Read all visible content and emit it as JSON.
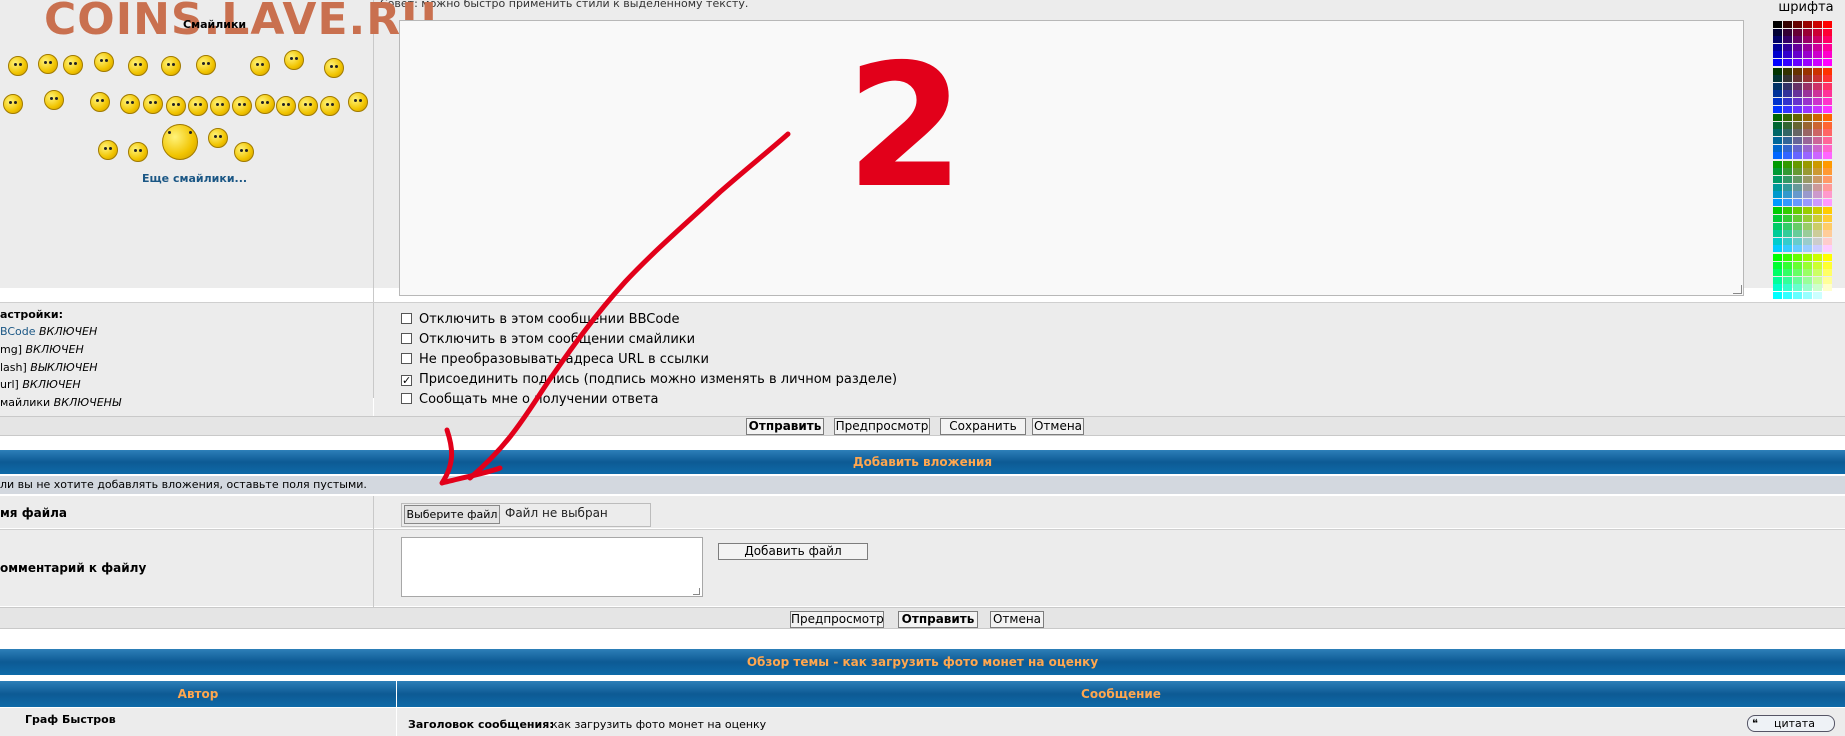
{
  "watermark": "COINS.LAVE.RU",
  "hint_text": "Совет: можно быстро применить стили к выделенному тексту.",
  "font_color_label": "шрифта",
  "smiles": {
    "title": "Смайлики",
    "more": "Еще смайлики..."
  },
  "settings": {
    "title": "астройки:",
    "lines": [
      {
        "label": "BCode",
        "value": "ВКЛЮЧЕН"
      },
      {
        "label": "mg]",
        "value": "ВКЛЮЧЕН"
      },
      {
        "label": "lash]",
        "value": "ВЫКЛЮЧЕН"
      },
      {
        "label": "url]",
        "value": "ВКЛЮЧЕН"
      },
      {
        "label": "майлики",
        "value": "ВКЛЮЧЕНЫ"
      }
    ]
  },
  "options": [
    {
      "label": "Отключить в этом сообщении BBCode",
      "checked": false
    },
    {
      "label": "Отключить в этом сообщении смайлики",
      "checked": false
    },
    {
      "label": "Не преобразовывать адреса URL в ссылки",
      "checked": false
    },
    {
      "label": "Присоединить подпись (подпись можно изменять в личном разделе)",
      "checked": true
    },
    {
      "label": "Сообщать мне о получении ответа",
      "checked": false
    }
  ],
  "post_buttons": {
    "submit": "Отправить",
    "preview": "Предпросмотр",
    "save": "Сохранить",
    "cancel": "Отмена"
  },
  "attachments": {
    "header": "Добавить вложения",
    "hint": "ли вы не хотите добавлять вложения, оставьте поля пустыми.",
    "filename_label": "мя файла",
    "choose_file": "Выберите файл",
    "no_file": "Файл не выбран",
    "comment_label": "омментарий к файлу",
    "add_file": "Добавить файл",
    "preview": "Предпросмотр",
    "submit": "Отправить",
    "cancel": "Отмена"
  },
  "topic_review": {
    "header": "Обзор темы - как загрузить фото монет на оценку",
    "author_col": "Автор",
    "message_col": "Сообщение",
    "author": "Граф Быстров",
    "subject_label": "Заголовок сообщения:",
    "subject": "как загрузить фото монет на оценку",
    "quote": "цитата"
  },
  "annotation": {
    "digit": "2",
    "color": "#e2001a"
  }
}
